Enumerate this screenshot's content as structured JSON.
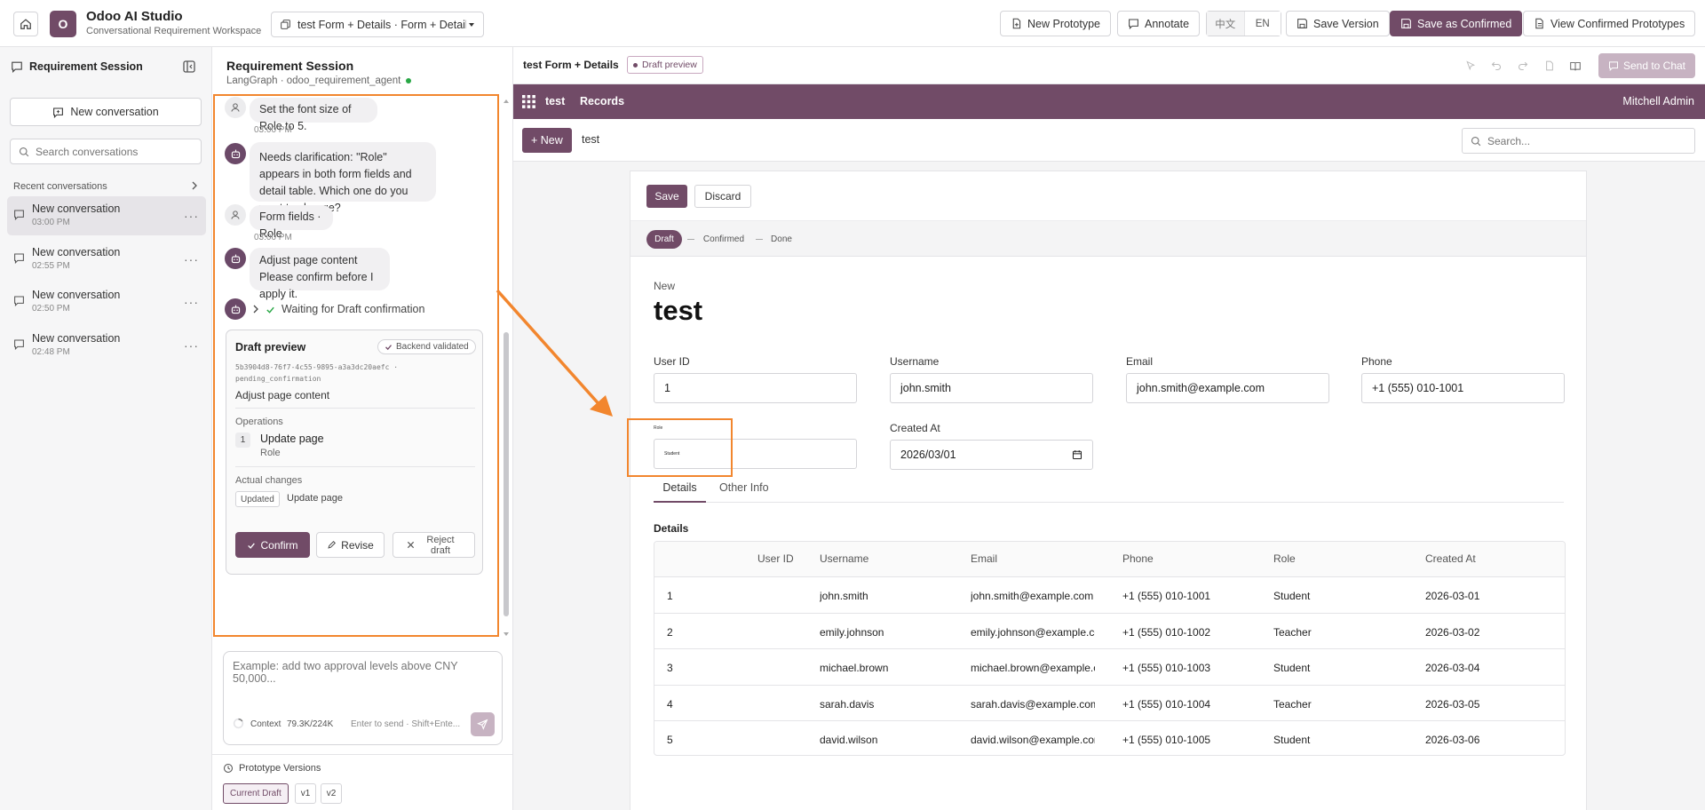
{
  "app": {
    "logo_letter": "O",
    "name": "Odoo AI Studio",
    "subtitle": "Conversational Requirement Workspace"
  },
  "tab": {
    "title": "test Form + Details · Form + Details"
  },
  "toolbar": {
    "new_prototype": "New Prototype",
    "annotate": "Annotate",
    "lang_zh": "中文",
    "lang_en": "EN",
    "save_version": "Save Version",
    "save_confirmed": "Save as Confirmed",
    "view_confirmed": "View Confirmed Prototypes"
  },
  "colors": {
    "brand": "#714b67",
    "accent_orange": "#f2862e",
    "success": "#28a745"
  },
  "sidebar": {
    "title": "Requirement Session",
    "new_conversation": "New conversation",
    "search_placeholder": "Search conversations",
    "recent_label": "Recent conversations",
    "conversations": [
      {
        "title": "New conversation",
        "time": "03:00 PM"
      },
      {
        "title": "New conversation",
        "time": "02:55 PM"
      },
      {
        "title": "New conversation",
        "time": "02:50 PM"
      },
      {
        "title": "New conversation",
        "time": "02:48 PM"
      }
    ]
  },
  "chat": {
    "title": "Requirement Session",
    "subtitle": "LangGraph · odoo_requirement_agent",
    "messages": {
      "m1": "Set the font size of Role to 5.",
      "m1_time": "03:00 PM",
      "m2": "Needs clarification: \"Role\" appears in both form fields and detail table. Which one do you want to change?",
      "m3": "Form fields · Role",
      "m3_time": "03:00 PM",
      "m4_line1": "Adjust page content",
      "m4_line2": "Please confirm before I apply it.",
      "status": "Waiting for Draft confirmation"
    },
    "draft": {
      "title": "Draft preview",
      "badge": "Backend validated",
      "id_line1": "5b3904d8-76f7-4c55-9895-a3a3dc20aefc ·",
      "id_line2": "pending_confirmation",
      "summary": "Adjust page content",
      "operations_label": "Operations",
      "op_index": "1",
      "op_title": "Update page",
      "op_sub": "Role",
      "changes_label": "Actual changes",
      "change_badge": "Updated",
      "change_text": "Update page",
      "confirm": "Confirm",
      "revise": "Revise",
      "reject": "Reject draft"
    },
    "input_placeholder": "Example: add two approval levels above CNY 50,000...",
    "context_label": "Context",
    "context_value": "79.3K/224K",
    "send_hint": "Enter to send · Shift+Ente...",
    "versions": {
      "label": "Prototype Versions",
      "items": [
        "Current Draft",
        "v1",
        "v2"
      ]
    }
  },
  "preview": {
    "title": "test Form + Details",
    "badge": "Draft preview",
    "send_to_chat": "Send to Chat",
    "odoo": {
      "app_name": "test",
      "menu_records": "Records",
      "user": "Mitchell Admin",
      "new_button": "+ New",
      "breadcrumb": "test",
      "search_placeholder": "Search..."
    },
    "form": {
      "save": "Save",
      "discard": "Discard",
      "stages": [
        "Draft",
        "Confirmed",
        "Done"
      ],
      "new_label": "New",
      "record_title": "test",
      "fields": {
        "user_id_label": "User ID",
        "user_id": "1",
        "username_label": "Username",
        "username": "john.smith",
        "email_label": "Email",
        "email": "john.smith@example.com",
        "phone_label": "Phone",
        "phone": "+1 (555) 010-1001",
        "role_label": "Role",
        "role": "Student",
        "created_label": "Created At",
        "created": "2026/03/01"
      },
      "tabs": [
        "Details",
        "Other Info"
      ],
      "details_label": "Details",
      "table": {
        "headers": [
          "User ID",
          "Username",
          "Email",
          "Phone",
          "Role",
          "Created At"
        ],
        "rows": [
          [
            "1",
            "john.smith",
            "john.smith@example.com",
            "+1 (555) 010-1001",
            "Student",
            "2026-03-01"
          ],
          [
            "2",
            "emily.johnson",
            "emily.johnson@example.com",
            "+1 (555) 010-1002",
            "Teacher",
            "2026-03-02"
          ],
          [
            "3",
            "michael.brown",
            "michael.brown@example.com",
            "+1 (555) 010-1003",
            "Student",
            "2026-03-04"
          ],
          [
            "4",
            "sarah.davis",
            "sarah.davis@example.com",
            "+1 (555) 010-1004",
            "Teacher",
            "2026-03-05"
          ],
          [
            "5",
            "david.wilson",
            "david.wilson@example.com",
            "+1 (555) 010-1005",
            "Student",
            "2026-03-06"
          ]
        ]
      }
    }
  }
}
